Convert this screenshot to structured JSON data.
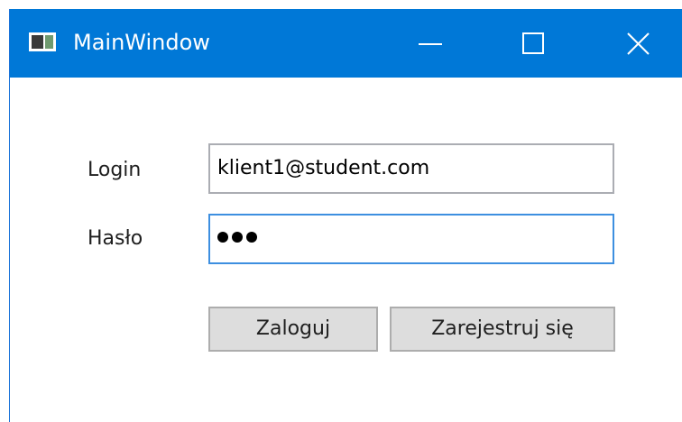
{
  "window": {
    "title": "MainWindow",
    "titlebar_color": "#0078d7",
    "controls": {
      "minimize_icon": "minimize-icon",
      "maximize_icon": "maximize-icon",
      "close_icon": "close-icon"
    }
  },
  "form": {
    "login_label": "Login",
    "login_value": "klient1@student.com",
    "password_label": "Hasło",
    "password_masked_length": 3,
    "focus_color": "#3d8fe0"
  },
  "buttons": {
    "login_label": "Zaloguj",
    "register_label": "Zarejestruj się"
  }
}
